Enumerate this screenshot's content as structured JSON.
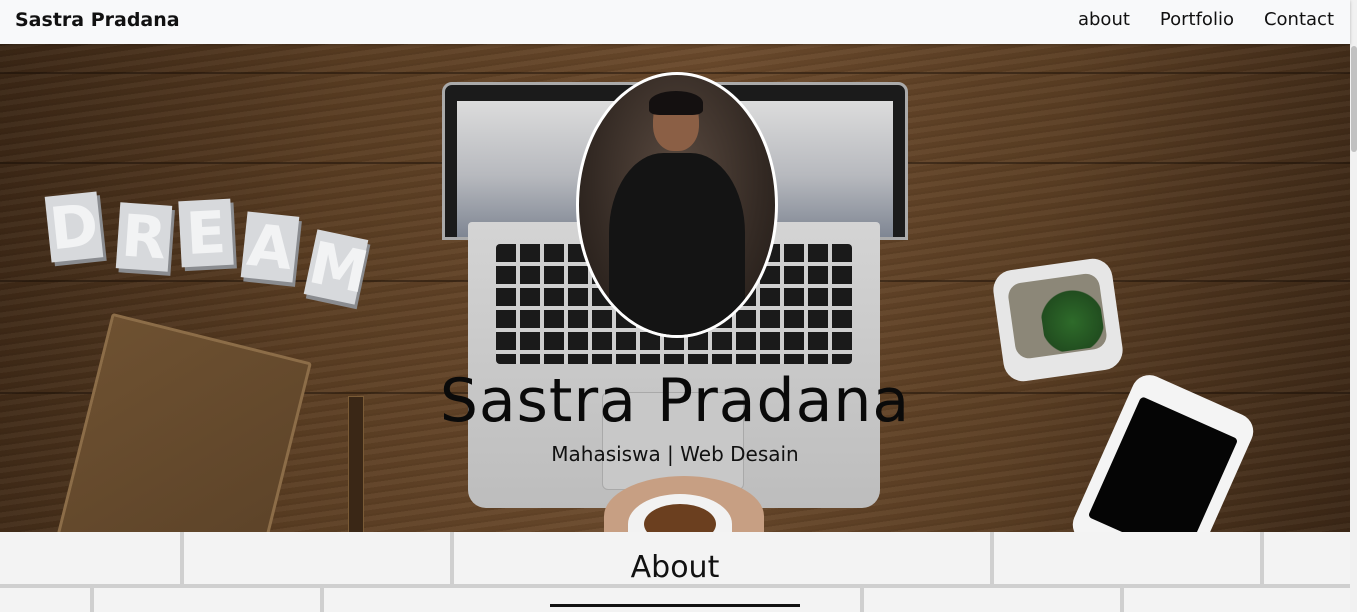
{
  "navbar": {
    "brand": "Sastra Pradana",
    "links": [
      "about",
      "Portfolio",
      "Contact"
    ]
  },
  "hero": {
    "title": "Sastra Pradana",
    "subtitle": "Mahasiswa | Web Desain",
    "decor_letters": [
      "D",
      "R",
      "E",
      "A",
      "M"
    ]
  },
  "about": {
    "title": "About"
  },
  "colors": {
    "navbar_bg": "#f8f9fa",
    "wood": "#6b4a2c",
    "text": "#0a0a0a"
  }
}
